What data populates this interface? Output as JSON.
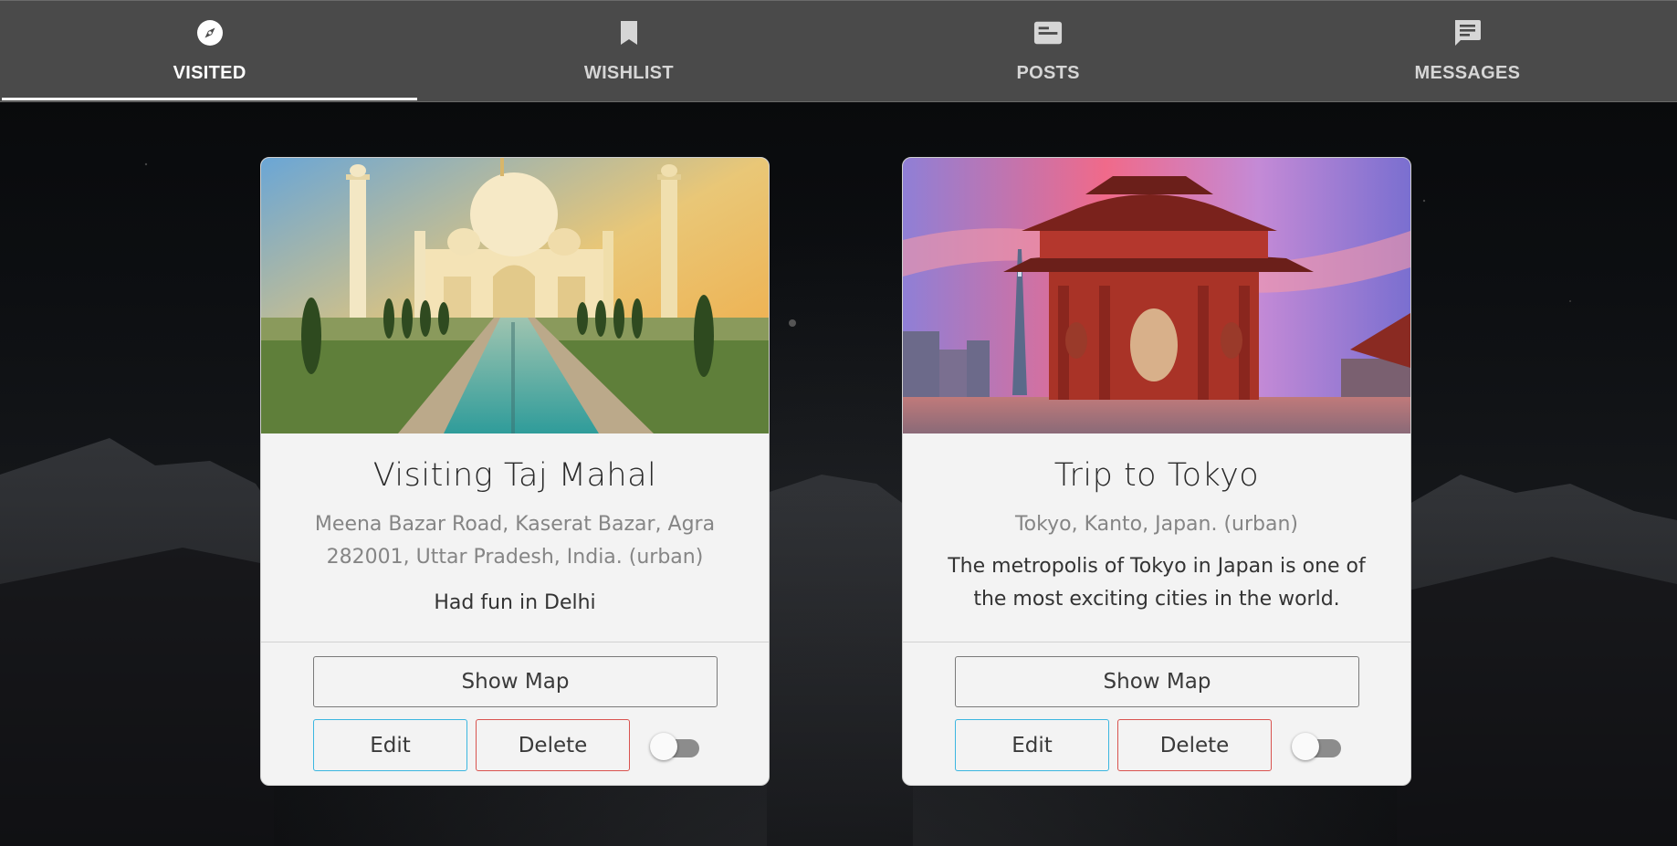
{
  "nav": {
    "tabs": [
      {
        "label": "VISITED",
        "icon": "compass-icon",
        "active": true
      },
      {
        "label": "WISHLIST",
        "icon": "bookmark-icon",
        "active": false
      },
      {
        "label": "POSTS",
        "icon": "post-icon",
        "active": false
      },
      {
        "label": "MESSAGES",
        "icon": "message-icon",
        "active": false
      }
    ]
  },
  "cards": [
    {
      "title": "Visiting Taj Mahal",
      "address": "Meena Bazar Road, Kaserat Bazar, Agra 282001, Uttar Pradesh, India. (urban)",
      "description": "Had fun in Delhi",
      "show_map_label": "Show Map",
      "edit_label": "Edit",
      "delete_label": "Delete",
      "toggle_on": false,
      "image": "taj-mahal-photo"
    },
    {
      "title": "Trip to Tokyo",
      "address": "Tokyo, Kanto, Japan. (urban)",
      "description": "The metropolis of Tokyo in Japan is one of the most exciting cities in the world.",
      "show_map_label": "Show Map",
      "edit_label": "Edit",
      "delete_label": "Delete",
      "toggle_on": false,
      "image": "tokyo-gate-photo"
    }
  ],
  "colors": {
    "nav_bg": "#4a4a4a",
    "edit_border": "#3bb6e0",
    "delete_border": "#d9534f",
    "card_bg": "#f3f3f3"
  }
}
